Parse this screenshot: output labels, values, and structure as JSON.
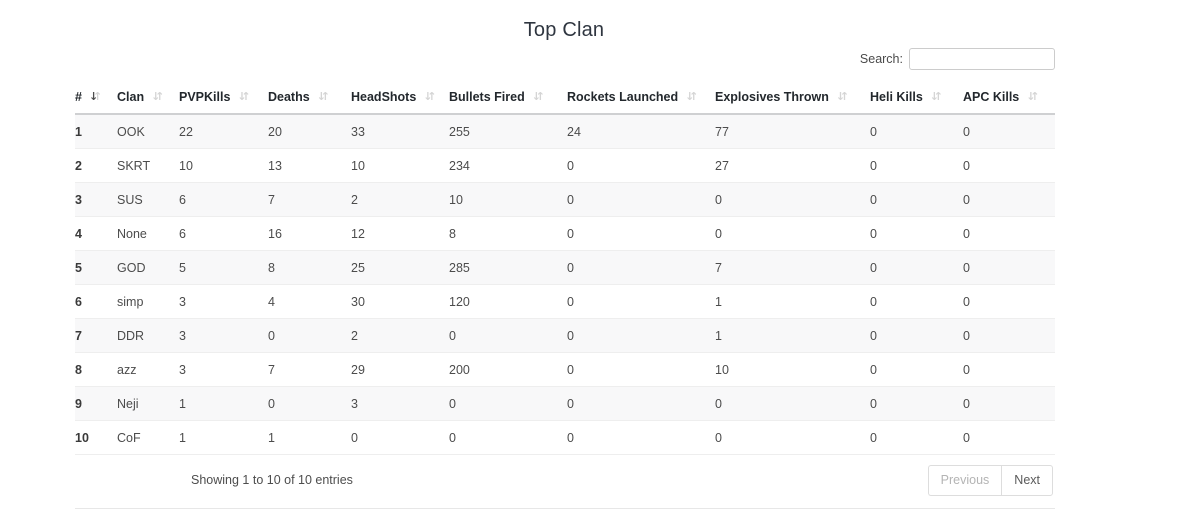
{
  "page": {
    "title": "Top Clan"
  },
  "search": {
    "label": "Search:",
    "value": "",
    "placeholder": ""
  },
  "table": {
    "columns": [
      {
        "label": "#",
        "sort_state": "asc"
      },
      {
        "label": "Clan",
        "sort_state": "none"
      },
      {
        "label": "PVPKills",
        "sort_state": "none"
      },
      {
        "label": "Deaths",
        "sort_state": "none"
      },
      {
        "label": "HeadShots",
        "sort_state": "none"
      },
      {
        "label": "Bullets Fired",
        "sort_state": "none"
      },
      {
        "label": "Rockets Launched",
        "sort_state": "none"
      },
      {
        "label": "Explosives Thrown",
        "sort_state": "none"
      },
      {
        "label": "Heli Kills",
        "sort_state": "none"
      },
      {
        "label": "APC Kills",
        "sort_state": "none"
      }
    ],
    "rows": [
      {
        "rank": "1",
        "clan": "OOK",
        "pvpkills": "22",
        "deaths": "20",
        "headshots": "33",
        "bullets_fired": "255",
        "rockets_launched": "24",
        "explosives_thrown": "77",
        "heli_kills": "0",
        "apc_kills": "0"
      },
      {
        "rank": "2",
        "clan": "SKRT",
        "pvpkills": "10",
        "deaths": "13",
        "headshots": "10",
        "bullets_fired": "234",
        "rockets_launched": "0",
        "explosives_thrown": "27",
        "heli_kills": "0",
        "apc_kills": "0"
      },
      {
        "rank": "3",
        "clan": "SUS",
        "pvpkills": "6",
        "deaths": "7",
        "headshots": "2",
        "bullets_fired": "10",
        "rockets_launched": "0",
        "explosives_thrown": "0",
        "heli_kills": "0",
        "apc_kills": "0"
      },
      {
        "rank": "4",
        "clan": "None",
        "pvpkills": "6",
        "deaths": "16",
        "headshots": "12",
        "bullets_fired": "8",
        "rockets_launched": "0",
        "explosives_thrown": "0",
        "heli_kills": "0",
        "apc_kills": "0"
      },
      {
        "rank": "5",
        "clan": "GOD",
        "pvpkills": "5",
        "deaths": "8",
        "headshots": "25",
        "bullets_fired": "285",
        "rockets_launched": "0",
        "explosives_thrown": "7",
        "heli_kills": "0",
        "apc_kills": "0"
      },
      {
        "rank": "6",
        "clan": "simp",
        "pvpkills": "3",
        "deaths": "4",
        "headshots": "30",
        "bullets_fired": "120",
        "rockets_launched": "0",
        "explosives_thrown": "1",
        "heli_kills": "0",
        "apc_kills": "0"
      },
      {
        "rank": "7",
        "clan": "DDR",
        "pvpkills": "3",
        "deaths": "0",
        "headshots": "2",
        "bullets_fired": "0",
        "rockets_launched": "0",
        "explosives_thrown": "1",
        "heli_kills": "0",
        "apc_kills": "0"
      },
      {
        "rank": "8",
        "clan": "azz",
        "pvpkills": "3",
        "deaths": "7",
        "headshots": "29",
        "bullets_fired": "200",
        "rockets_launched": "0",
        "explosives_thrown": "10",
        "heli_kills": "0",
        "apc_kills": "0"
      },
      {
        "rank": "9",
        "clan": "Neji",
        "pvpkills": "1",
        "deaths": "0",
        "headshots": "3",
        "bullets_fired": "0",
        "rockets_launched": "0",
        "explosives_thrown": "0",
        "heli_kills": "0",
        "apc_kills": "0"
      },
      {
        "rank": "10",
        "clan": "CoF",
        "pvpkills": "1",
        "deaths": "1",
        "headshots": "0",
        "bullets_fired": "0",
        "rockets_launched": "0",
        "explosives_thrown": "0",
        "heli_kills": "0",
        "apc_kills": "0"
      }
    ]
  },
  "footer": {
    "info": "Showing 1 to 10 of 10 entries",
    "previous_label": "Previous",
    "next_label": "Next"
  },
  "icons": {
    "sort_down": "↓",
    "sort_up": "↑"
  },
  "colors": {
    "title": "#2f3640",
    "header_text": "#23282d",
    "body_text": "#4c4c4c",
    "stripe": "#f8f8f9",
    "row_border": "#eeeeee",
    "header_border": "#cfd0d2",
    "sort_inactive": "#d5d5d5",
    "sort_active": "#4c4c4c"
  }
}
